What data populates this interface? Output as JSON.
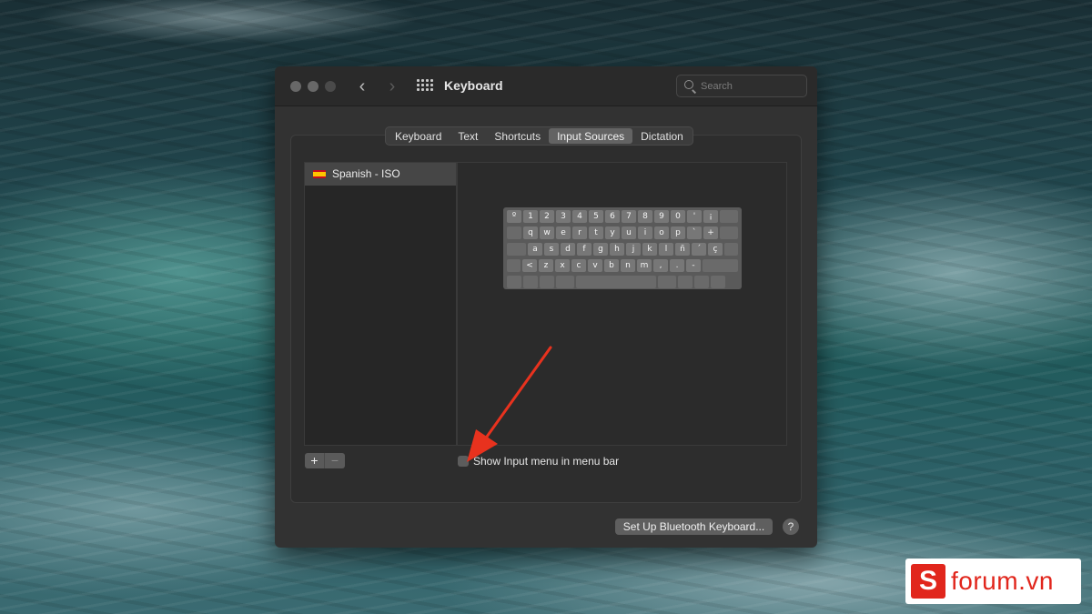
{
  "window": {
    "title": "Keyboard",
    "search_placeholder": "Search"
  },
  "tabs": [
    {
      "label": "Keyboard",
      "active": false
    },
    {
      "label": "Text",
      "active": false
    },
    {
      "label": "Shortcuts",
      "active": false
    },
    {
      "label": "Input Sources",
      "active": true
    },
    {
      "label": "Dictation",
      "active": false
    }
  ],
  "input_sources": {
    "items": [
      {
        "label": "Spanish - ISO",
        "flag": "spain-flag-icon",
        "selected": true
      }
    ],
    "add_label": "+",
    "remove_label": "−"
  },
  "keyboard_preview": {
    "rows": [
      [
        "º",
        "1",
        "2",
        "3",
        "4",
        "5",
        "6",
        "7",
        "8",
        "9",
        "0",
        "'",
        "¡"
      ],
      [
        "q",
        "w",
        "e",
        "r",
        "t",
        "y",
        "u",
        "i",
        "o",
        "p",
        "`",
        "+"
      ],
      [
        "a",
        "s",
        "d",
        "f",
        "g",
        "h",
        "j",
        "k",
        "l",
        "ñ",
        "´",
        "ç"
      ],
      [
        "<",
        "z",
        "x",
        "c",
        "v",
        "b",
        "n",
        "m",
        ",",
        ".",
        "-"
      ]
    ]
  },
  "show_input_menu": {
    "label": "Show Input menu in menu bar",
    "checked": false
  },
  "footer": {
    "bluetooth_label": "Set Up Bluetooth Keyboard...",
    "help_label": "?"
  },
  "annotation": {
    "arrow_color": "#e8321e"
  },
  "watermark": {
    "text": "forum.vn",
    "brand_color": "#e1261c"
  }
}
